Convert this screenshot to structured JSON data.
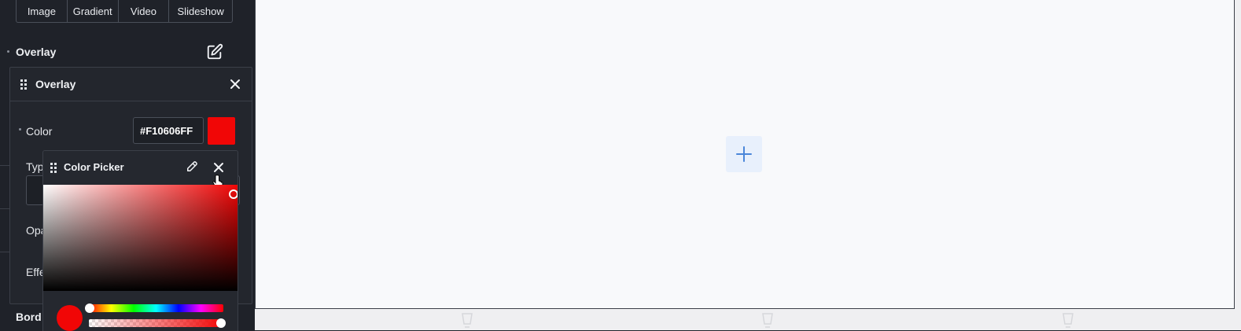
{
  "background_tabs": [
    "Image",
    "Gradient",
    "Video",
    "Slideshow"
  ],
  "overlay_section": {
    "label": "Overlay",
    "edit_icon": "edit-icon"
  },
  "overlay_panel": {
    "title": "Overlay",
    "color_label": "Color",
    "color_value": "#F10606FF",
    "swatch_color": "#F10606",
    "type_label": "Typ",
    "opacity_label": "Opa",
    "effect_label": "Effe"
  },
  "color_picker": {
    "title": "Color Picker",
    "hue_position": 0,
    "alpha_position": 1
  },
  "border_label": "Bord",
  "canvas": {
    "add_button": "plus-icon"
  }
}
